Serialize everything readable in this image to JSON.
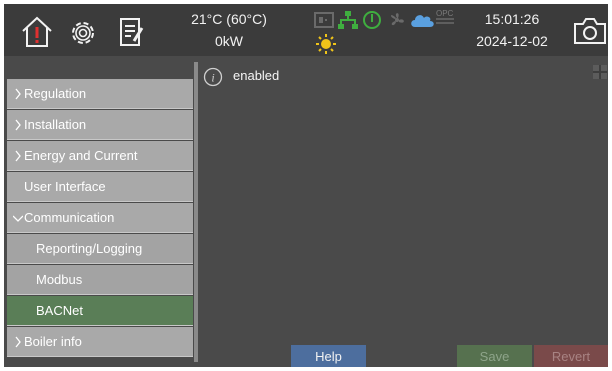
{
  "header": {
    "temperature": "21°C (60°C)",
    "power": "0kW",
    "time": "15:01:26",
    "date": "2024-12-02",
    "status_icons": [
      "electric-heater-icon",
      "network-icon",
      "power-icon",
      "fan-icon",
      "cloud-icon",
      "opc-icon",
      "sun-icon"
    ],
    "status_labels": {
      "opc": "OPC"
    }
  },
  "sidebar": {
    "items": [
      {
        "label": "Regulation",
        "expandable": true
      },
      {
        "label": "Installation",
        "expandable": true
      },
      {
        "label": "Energy and Current",
        "expandable": true
      },
      {
        "label": "User Interface",
        "expandable": false
      },
      {
        "label": "Communication",
        "expandable": true,
        "expanded": true
      },
      {
        "label": "Reporting/Logging",
        "sub": true
      },
      {
        "label": "Modbus",
        "sub": true
      },
      {
        "label": "BACNet",
        "sub": true,
        "active": true
      },
      {
        "label": "Boiler info",
        "expandable": true
      }
    ]
  },
  "main": {
    "status_text": "enabled"
  },
  "buttons": {
    "help": "Help",
    "save": "Save",
    "revert": "Revert"
  },
  "colors": {
    "screen_bg": "#4a4a4a",
    "topbar_bg": "#3b3b3b",
    "nav_item_bg": "#a9a9a9",
    "nav_active_bg": "#5a7e57",
    "help_button": "#4d6e9e",
    "save_button_disabled": "#56714f",
    "revert_button_disabled": "#7a4a4a",
    "alarm_red": "#e03030",
    "network_green": "#3fae3f",
    "cloud_blue": "#5aa0e0",
    "sun_yellow": "#f0c419"
  }
}
